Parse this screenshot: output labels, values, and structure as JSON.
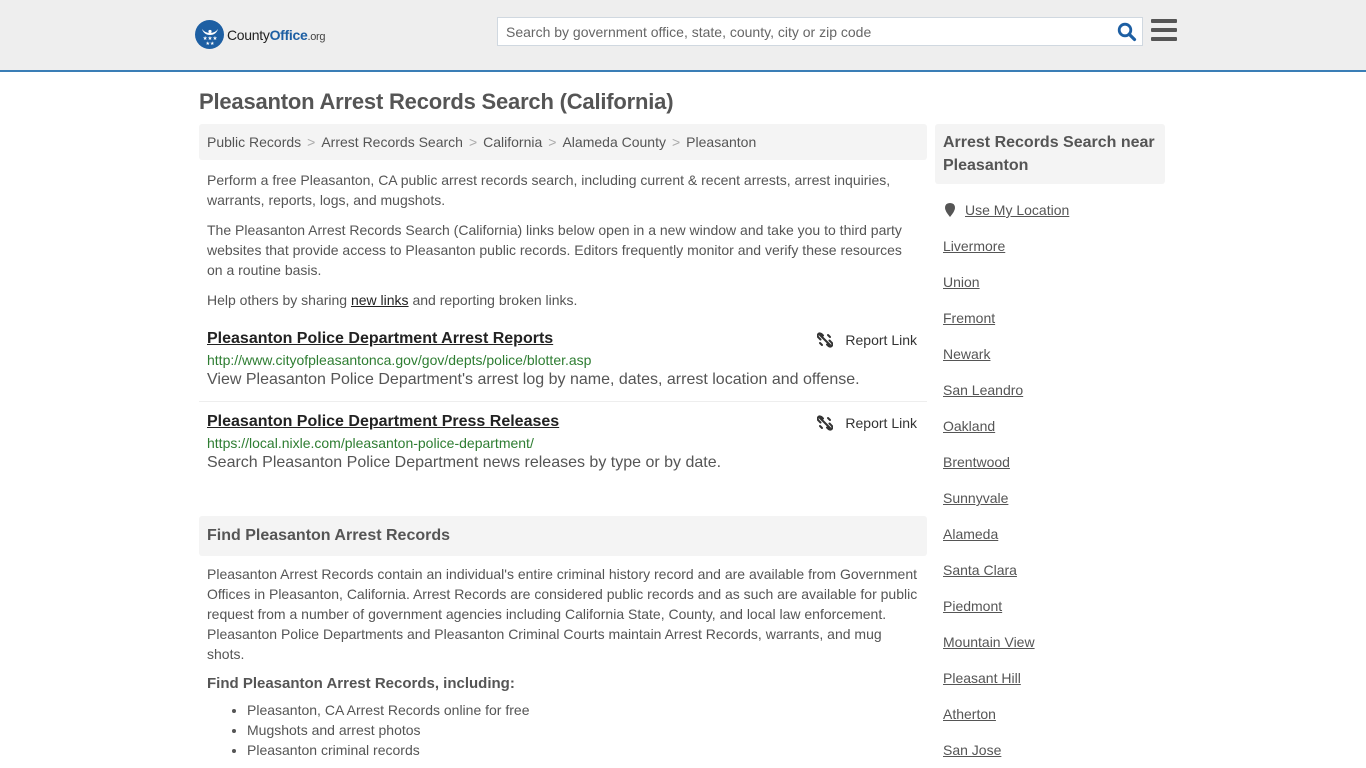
{
  "header": {
    "logo": {
      "brand_county": "County",
      "brand_office": "Office",
      "brand_tld": ".org"
    },
    "search": {
      "placeholder": "Search by government office, state, county, city or zip code",
      "value": ""
    },
    "icons": {
      "search": "search-icon",
      "menu": "hamburger-menu-icon"
    }
  },
  "page": {
    "title": "Pleasanton Arrest Records Search (California)"
  },
  "breadcrumb": [
    {
      "label": "Public Records"
    },
    {
      "label": "Arrest Records Search"
    },
    {
      "label": "California"
    },
    {
      "label": "Alameda County"
    },
    {
      "label": "Pleasanton"
    }
  ],
  "breadcrumb_separator": ">",
  "intro": {
    "p1": "Perform a free Pleasanton, CA public arrest records search, including current & recent arrests, arrest inquiries, warrants, reports, logs, and mugshots.",
    "p2": "The Pleasanton Arrest Records Search (California) links below open in a new window and take you to third party websites that provide access to Pleasanton public records. Editors frequently monitor and verify these resources on a routine basis.",
    "p3_before": "Help others by sharing ",
    "p3_link": "new links",
    "p3_after": " and reporting broken links."
  },
  "results": [
    {
      "title": "Pleasanton Police Department Arrest Reports",
      "url": "http://www.cityofpleasantonca.gov/gov/depts/police/blotter.asp",
      "description": "View Pleasanton Police Department's arrest log by name, dates, arrest location and offense.",
      "report_label": "Report Link"
    },
    {
      "title": "Pleasanton Police Department Press Releases",
      "url": "https://local.nixle.com/pleasanton-police-department/",
      "description": "Search Pleasanton Police Department news releases by type or by date.",
      "report_label": "Report Link"
    }
  ],
  "find_section": {
    "heading": "Find Pleasanton Arrest Records",
    "body": "Pleasanton Arrest Records contain an individual's entire criminal history record and are available from Government Offices in Pleasanton, California. Arrest Records are considered public records and as such are available for public request from a number of government agencies including California State, County, and local law enforcement. Pleasanton Police Departments and Pleasanton Criminal Courts maintain Arrest Records, warrants, and mug shots.",
    "subheading": "Find Pleasanton Arrest Records, including:",
    "bullets": [
      "Pleasanton, CA Arrest Records online for free",
      "Mugshots and arrest photos",
      "Pleasanton criminal records"
    ]
  },
  "sidebar": {
    "heading": "Arrest Records Search near Pleasanton",
    "use_location": "Use My Location",
    "cities": [
      "Livermore",
      "Union",
      "Fremont",
      "Newark",
      "San Leandro",
      "Oakland",
      "Brentwood",
      "Sunnyvale",
      "Alameda",
      "Santa Clara",
      "Piedmont",
      "Mountain View",
      "Pleasant Hill",
      "Atherton",
      "San Jose"
    ]
  },
  "colors": {
    "brand_blue": "#1d5fa3",
    "header_border": "#3a7eb6",
    "url_green": "#2e7d32",
    "text": "#555555",
    "panel_bg": "#f4f4f4"
  }
}
